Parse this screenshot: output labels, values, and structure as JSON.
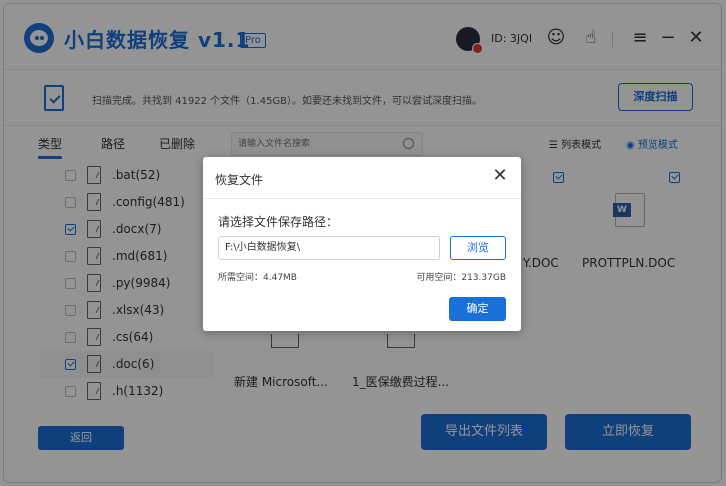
{
  "app": {
    "title": "小白数据恢复 v1.1",
    "badge": "Pro",
    "user_id": "ID: 3JQI"
  },
  "toolbar_icons": [
    "robot-icon",
    "hand-icon",
    "menu-icon",
    "minimize-icon",
    "close-icon"
  ],
  "status": {
    "text": "扫描完成。共找到 41922 个文件（1.45GB）。如要还未找到文件，可以尝试深度扫描。",
    "deep_scan_label": "深度扫描"
  },
  "tabs": [
    {
      "label": "类型",
      "active": true
    },
    {
      "label": "路径",
      "active": false
    },
    {
      "label": "已删除",
      "active": false
    }
  ],
  "search": {
    "placeholder": "请输入文件名搜索"
  },
  "view_modes": {
    "list_label": "列表模式",
    "preview_label": "预览模式"
  },
  "file_types": [
    {
      "label": ".bat(52)",
      "checked": false
    },
    {
      "label": ".config(481)",
      "checked": false
    },
    {
      "label": ".docx(7)",
      "checked": true
    },
    {
      "label": ".md(681)",
      "checked": false
    },
    {
      "label": ".py(9984)",
      "checked": false
    },
    {
      "label": ".xlsx(43)",
      "checked": false
    },
    {
      "label": ".cs(64)",
      "checked": false
    },
    {
      "label": ".doc(6)",
      "checked": true
    },
    {
      "label": ".h(1132)",
      "checked": false
    }
  ],
  "tiles": {
    "tile1_name": "Y.DOC",
    "tile2_name": "PROTTPLN.DOC",
    "tile3_name": "新建 Microsoft...",
    "tile4_name": "1_医保缴费过程..."
  },
  "buttons": {
    "back": "返回",
    "export": "导出文件列表",
    "recover": "立即恢复"
  },
  "modal": {
    "title": "恢复文件",
    "prompt": "请选择文件保存路径：",
    "path_value": "F:\\小白数据恢复\\",
    "browse_label": "浏览",
    "needed_space": "所需空间：4.47MB",
    "free_space": "可用空间：213.37GB",
    "ok_label": "确定"
  },
  "colors": {
    "accent": "#1a6fd8",
    "overlay": "rgba(0,0,0,0.42)"
  }
}
